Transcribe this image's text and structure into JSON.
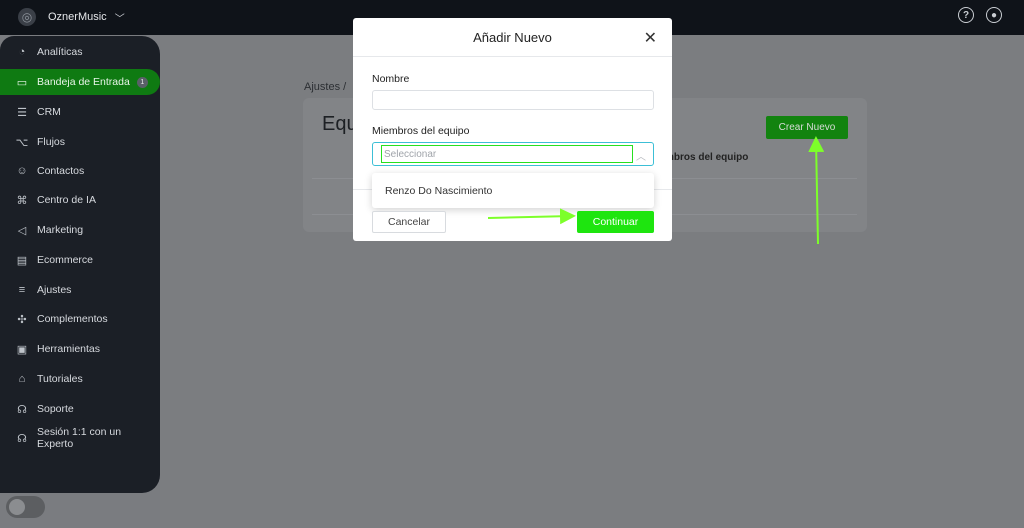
{
  "topbar": {
    "account_name": "OznerMusic",
    "help_icon": "question-circle-icon",
    "user_icon": "user-circle-icon"
  },
  "sidebar": {
    "items": [
      {
        "label": "Analíticas",
        "icon": "analytics-icon"
      },
      {
        "label": "Bandeja de Entrada",
        "icon": "inbox-chat-icon",
        "badge": "1",
        "active": true
      },
      {
        "label": "CRM",
        "icon": "list-icon"
      },
      {
        "label": "Flujos",
        "icon": "flow-icon"
      },
      {
        "label": "Contactos",
        "icon": "contacts-icon"
      },
      {
        "label": "Centro de IA",
        "icon": "ai-icon"
      },
      {
        "label": "Marketing",
        "icon": "megaphone-icon"
      },
      {
        "label": "Ecommerce",
        "icon": "store-icon"
      },
      {
        "label": "Ajustes",
        "icon": "sliders-icon"
      },
      {
        "label": "Complementos",
        "icon": "puzzle-icon"
      },
      {
        "label": "Herramientas",
        "icon": "toolbox-icon"
      },
      {
        "label": "Tutoriales",
        "icon": "graduation-cap-icon"
      },
      {
        "label": "Soporte",
        "icon": "headset-icon"
      },
      {
        "label": "Sesión 1:1 con un Experto",
        "icon": "headset-icon"
      }
    ]
  },
  "background": {
    "breadcrumb": "Ajustes  /",
    "page_title": "Equ",
    "create_button": "Crear Nuevo",
    "column_header": "mbros del equipo"
  },
  "modal": {
    "title": "Añadir Nuevo",
    "name_label": "Nombre",
    "name_value": "",
    "members_label": "Miembros del equipo",
    "members_placeholder": "Seleccionar",
    "dropdown_options": [
      "Renzo Do Nascimiento"
    ],
    "cancel_label": "Cancelar",
    "continue_label": "Continuar"
  },
  "colors": {
    "accent_green": "#1ee50f",
    "sidebar_active": "#0f7a12",
    "annotation_arrow": "#7dff2a"
  }
}
